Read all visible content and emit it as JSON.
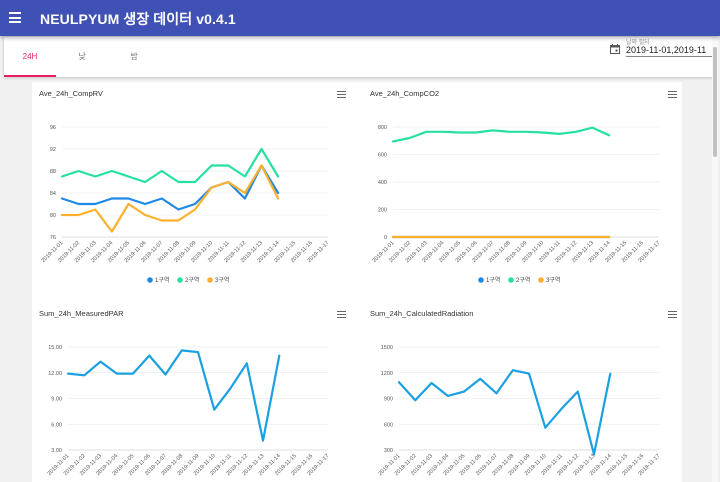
{
  "app": {
    "title": "NEULPYUM 생장 데이터 v0.4.1"
  },
  "tabs": [
    {
      "label": "24H",
      "active": true
    },
    {
      "label": "낮",
      "active": false
    },
    {
      "label": "밤",
      "active": false
    }
  ],
  "date_filter": {
    "label": "날짜 필터",
    "value": "2019-11-01,2019-11"
  },
  "icons": {
    "menu": "menu-icon",
    "calendar": "calendar-icon",
    "chart_menu": "hamburger-icon"
  },
  "colors": {
    "appbar": "#3f51b5",
    "tab_active": "#e91e63",
    "series1": "#1e88e5",
    "series2": "#26e0a0",
    "series3": "#fbb12e",
    "single": "#1ba0e1"
  },
  "chart_data": [
    {
      "type": "line",
      "title": "Ave_24h_CompRV",
      "categories": [
        "2019-11-01",
        "2019-11-02",
        "2019-11-03",
        "2019-11-04",
        "2019-11-05",
        "2019-11-06",
        "2019-11-07",
        "2019-11-08",
        "2019-11-09",
        "2019-11-10",
        "2019-11-11",
        "2019-11-12",
        "2019-11-13",
        "2019-11-14",
        "2019-11-15",
        "2019-11-16",
        "2019-11-17"
      ],
      "yticks": [
        "76",
        "80",
        "84",
        "88",
        "92",
        "96"
      ],
      "ylim": [
        76,
        96
      ],
      "legend_position": "bottom",
      "series": [
        {
          "name": "1구역",
          "color": "#1e88e5",
          "values": [
            83,
            82,
            82,
            83,
            83,
            82,
            83,
            81,
            82,
            85,
            86,
            83,
            89,
            84
          ]
        },
        {
          "name": "2구역",
          "color": "#26e0a0",
          "values": [
            87,
            88,
            87,
            88,
            87,
            86,
            88,
            86,
            86,
            89,
            89,
            87,
            92,
            87
          ]
        },
        {
          "name": "3구역",
          "color": "#fbb12e",
          "values": [
            80,
            80,
            81,
            77,
            82,
            80,
            79,
            79,
            81,
            85,
            86,
            84,
            89,
            83
          ]
        }
      ]
    },
    {
      "type": "line",
      "title": "Ave_24h_CompCO2",
      "categories": [
        "2019-11-01",
        "2019-11-02",
        "2019-11-03",
        "2019-11-04",
        "2019-11-05",
        "2019-11-06",
        "2019-11-07",
        "2019-11-08",
        "2019-11-09",
        "2019-11-10",
        "2019-11-11",
        "2019-11-12",
        "2019-11-13",
        "2019-11-14",
        "2019-11-15",
        "2019-11-16",
        "2019-11-17"
      ],
      "yticks": [
        "0",
        "200",
        "400",
        "600",
        "800"
      ],
      "ylim": [
        0,
        800
      ],
      "legend_position": "bottom",
      "series": [
        {
          "name": "1구역",
          "color": "#1e88e5",
          "values": [
            0,
            0,
            0,
            0,
            0,
            0,
            0,
            0,
            0,
            0,
            0,
            0,
            0,
            0
          ]
        },
        {
          "name": "2구역",
          "color": "#26e0a0",
          "values": [
            695,
            720,
            765,
            765,
            760,
            760,
            775,
            765,
            765,
            760,
            750,
            765,
            795,
            740
          ]
        },
        {
          "name": "3구역",
          "color": "#fbb12e",
          "values": [
            0,
            0,
            0,
            0,
            0,
            0,
            0,
            0,
            0,
            0,
            0,
            0,
            0,
            0
          ]
        }
      ]
    },
    {
      "type": "line",
      "title": "Sum_24h_MeasuredPAR",
      "categories": [
        "2019-11-01",
        "2019-11-02",
        "2019-11-03",
        "2019-11-04",
        "2019-11-05",
        "2019-11-06",
        "2019-11-07",
        "2019-11-08",
        "2019-11-09",
        "2019-11-10",
        "2019-11-11",
        "2019-11-12",
        "2019-11-13",
        "2019-11-14",
        "2019-11-15",
        "2019-11-16",
        "2019-11-17"
      ],
      "yticks": [
        "3.00",
        "6.00",
        "9.00",
        "12.00",
        "15.00"
      ],
      "ylim": [
        3,
        15
      ],
      "series": [
        {
          "name": "",
          "color": "#1ba0e1",
          "values": [
            11.9,
            11.7,
            13.3,
            11.9,
            11.9,
            14.0,
            11.8,
            14.6,
            14.4,
            7.7,
            10.2,
            13.1,
            4.1,
            14.0
          ]
        }
      ]
    },
    {
      "type": "line",
      "title": "Sum_24h_CalculatedRadiation",
      "categories": [
        "2019-11-01",
        "2019-11-02",
        "2019-11-03",
        "2019-11-04",
        "2019-11-05",
        "2019-11-06",
        "2019-11-07",
        "2019-11-08",
        "2019-11-09",
        "2019-11-10",
        "2019-11-11",
        "2019-11-12",
        "2019-11-13",
        "2019-11-14",
        "2019-11-15",
        "2019-11-16",
        "2019-11-17"
      ],
      "yticks": [
        "300",
        "600",
        "900",
        "1200",
        "1500"
      ],
      "ylim": [
        300,
        1500
      ],
      "series": [
        {
          "name": "",
          "color": "#1ba0e1",
          "values": [
            1090,
            880,
            1080,
            930,
            980,
            1130,
            960,
            1230,
            1190,
            560,
            780,
            980,
            250,
            1190
          ]
        }
      ]
    }
  ]
}
